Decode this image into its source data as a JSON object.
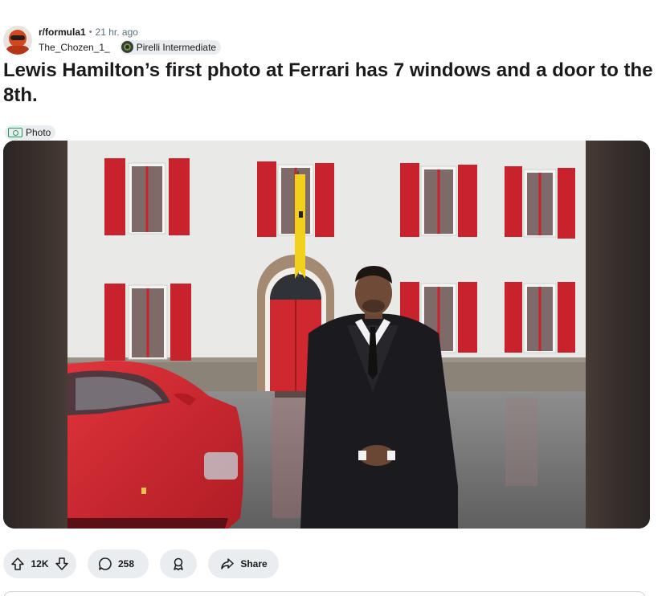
{
  "post": {
    "subreddit": "r/formula1",
    "time": "21 hr. ago",
    "author": "The_Chozen_1_",
    "author_flair": "Pirelli Intermediate",
    "title": "Lewis Hamilton’s first photo at Ferrari has 7 windows and a door to the 8th.",
    "tag": "Photo",
    "tag_icon": "camera-icon"
  },
  "actions": {
    "upvote_icon": "arrow-up-icon",
    "downvote_icon": "arrow-down-icon",
    "votes": "12K",
    "comment_icon": "speech-bubble-icon",
    "comments": "258",
    "award_icon": "award-icon",
    "share_icon": "share-arrow-icon",
    "share_label": "Share"
  },
  "colors": {
    "pill_bg": "#eaedef",
    "ferrari_red": "#c8232c",
    "flag_yellow": "#f2d11c",
    "wall": "#e9e9e7",
    "tag_green": "#1f9b55"
  }
}
